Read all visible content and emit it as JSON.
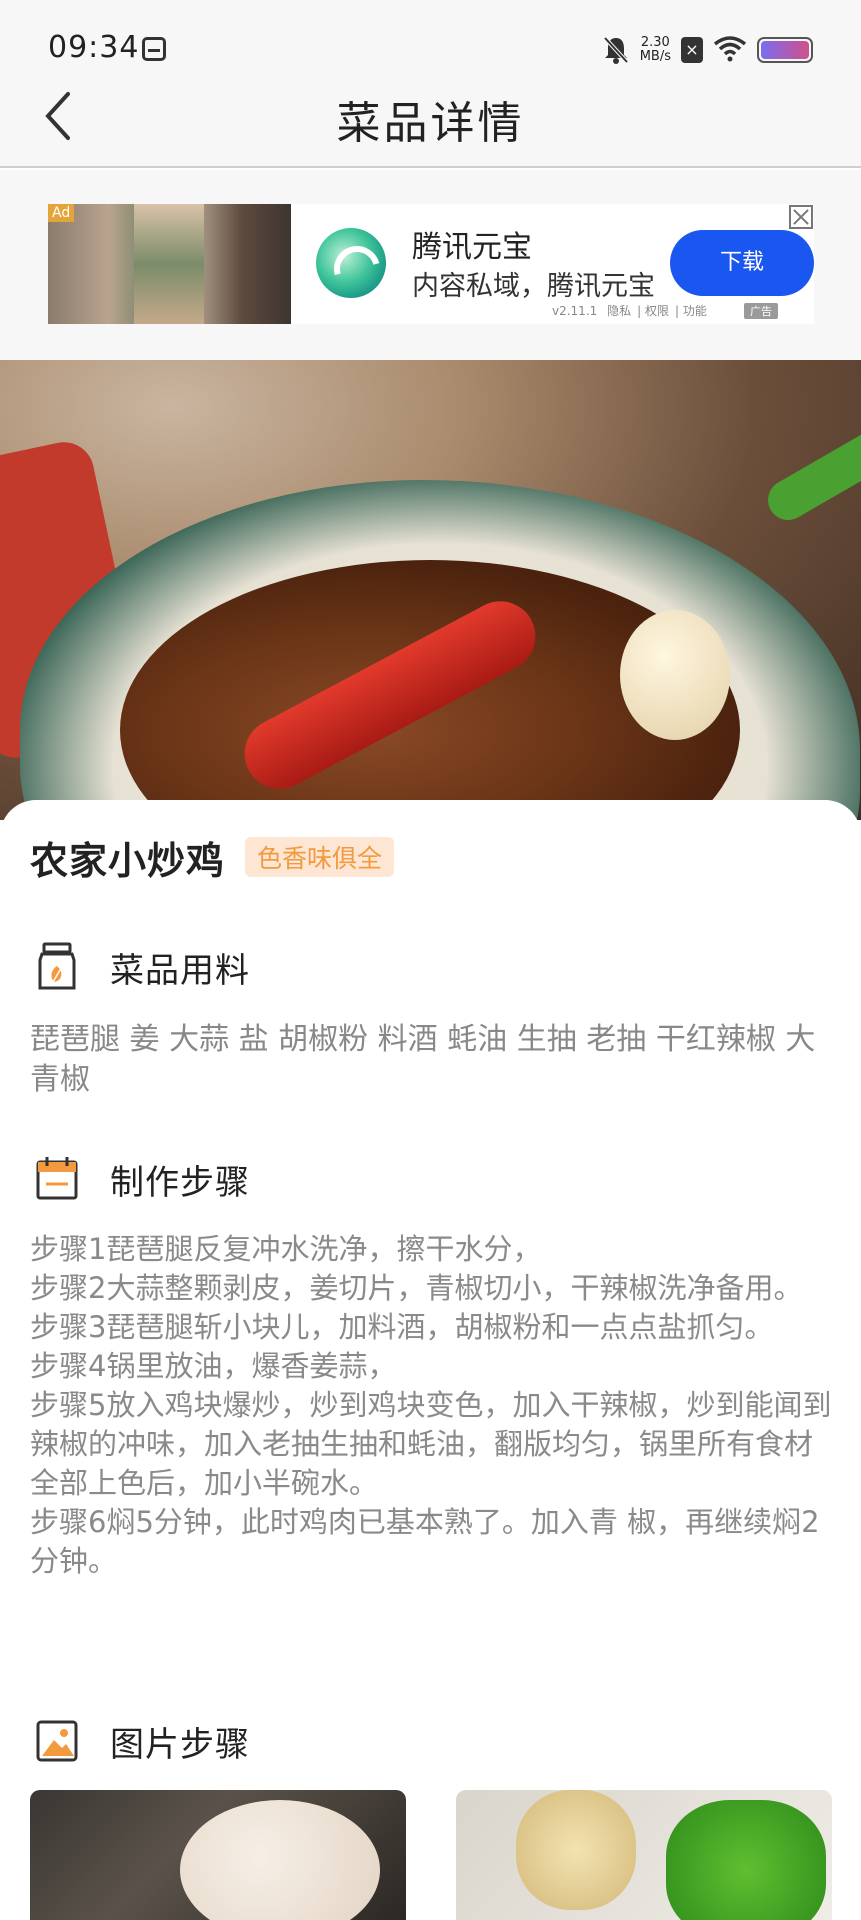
{
  "status_bar": {
    "time": "09:34",
    "net_speed_value": "2.30",
    "net_speed_unit": "MB/s"
  },
  "header": {
    "title": "菜品详情"
  },
  "ad": {
    "label": "Ad",
    "app_name": "腾讯元宝",
    "description": "内容私域，腾讯元宝",
    "download_label": "下载",
    "meta": [
      "v2.11.1",
      "隐私",
      "权限",
      "功能"
    ],
    "tag": "广告"
  },
  "dish": {
    "name": "农家小炒鸡",
    "tag": "色香味俱全"
  },
  "sections": {
    "ingredients_title": "菜品用料",
    "steps_title": "制作步骤",
    "photo_steps_title": "图片步骤"
  },
  "ingredients": "琵琶腿 姜 大蒜 盐 胡椒粉 料酒 蚝油 生抽 老抽 干红辣椒 大青椒",
  "steps": [
    "步骤1琵琶腿反复冲水洗净，擦干水分，",
    "步骤2大蒜整颗剥皮，姜切片，青椒切小，干辣椒洗净备用。",
    "步骤3琵琶腿斩小块儿，加料酒，胡椒粉和一点点盐抓匀。",
    "步骤4锅里放油，爆香姜蒜，",
    "步骤5放入鸡块爆炒，炒到鸡块变色，加入干辣椒，炒到能闻到辣椒的冲味，加入老抽生抽和蚝油，翻版均匀，锅里所有食材全部上色后，加小半碗水。",
    "步骤6焖5分钟，此时鸡肉已基本熟了。加入青 椒，再继续焖2分钟。"
  ],
  "icons": {
    "back": "chevron-left-icon",
    "ingredients": "jar-icon",
    "steps": "calendar-icon",
    "photo_steps": "image-icon",
    "ad_close": "close-icon"
  },
  "colors": {
    "accent_orange": "#f29a3d",
    "tag_bg": "#fde6d3",
    "download_blue": "#1a56f0"
  }
}
